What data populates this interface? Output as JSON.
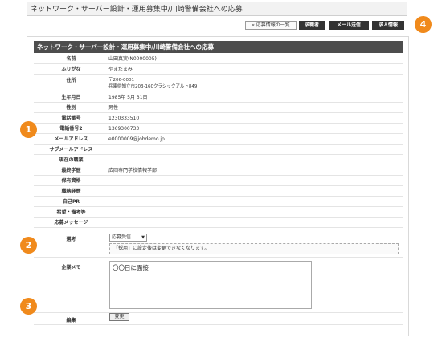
{
  "page": {
    "title": "ネットワーク・サーバー設計・運用募集中/川崎警備会社への応募"
  },
  "toolbar": {
    "back_list": "« 応募情報の一覧",
    "applicant": "求職者",
    "send_mail": "メール送信",
    "job_info": "求人情報"
  },
  "panel": {
    "header": "ネットワーク・サーバー設計・運用募集中/川崎警備会社への応募"
  },
  "fields": [
    {
      "label": "名前",
      "value": "山田真実(N0000005)"
    },
    {
      "label": "ふりがな",
      "value": "やまだまみ"
    },
    {
      "label": "住所",
      "value_lines": [
        "〒206-0001",
        "兵庫県知立市203-160クラシックアルト849"
      ]
    },
    {
      "label": "生年月日",
      "value": "1985年 5月 31日"
    },
    {
      "label": "性別",
      "value": "男性"
    },
    {
      "label": "電話番号",
      "value": "1230333510"
    },
    {
      "label": "電話番号2",
      "value": "1369300733"
    },
    {
      "label": "メールアドレス",
      "value": "e0000009@jobdemo.jp"
    },
    {
      "label": "サブメールアドレス",
      "value": ""
    },
    {
      "label": "現在の職業",
      "value": ""
    },
    {
      "label": "最終学歴",
      "value": "広岡専門学校情報学部"
    },
    {
      "label": "保有資格",
      "value": ""
    },
    {
      "label": "職務経歴",
      "value": ""
    },
    {
      "label": "自己PR",
      "value": ""
    },
    {
      "label": "希望・備考等",
      "value": ""
    },
    {
      "label": "応募メッセージ",
      "value": ""
    }
  ],
  "progress": {
    "label": "選考",
    "selected": "応募受信",
    "note": "「採用」に設定後は変更できなくなります。"
  },
  "memo": {
    "label": "企業メモ",
    "value": "〇〇日に面接"
  },
  "edit": {
    "label": "編集",
    "button": "変更"
  },
  "badges": [
    "1",
    "2",
    "3",
    "4"
  ],
  "colors": {
    "header_bg": "#4d4d4d",
    "badge": "#f08a1c",
    "dark_button": "#333333"
  }
}
